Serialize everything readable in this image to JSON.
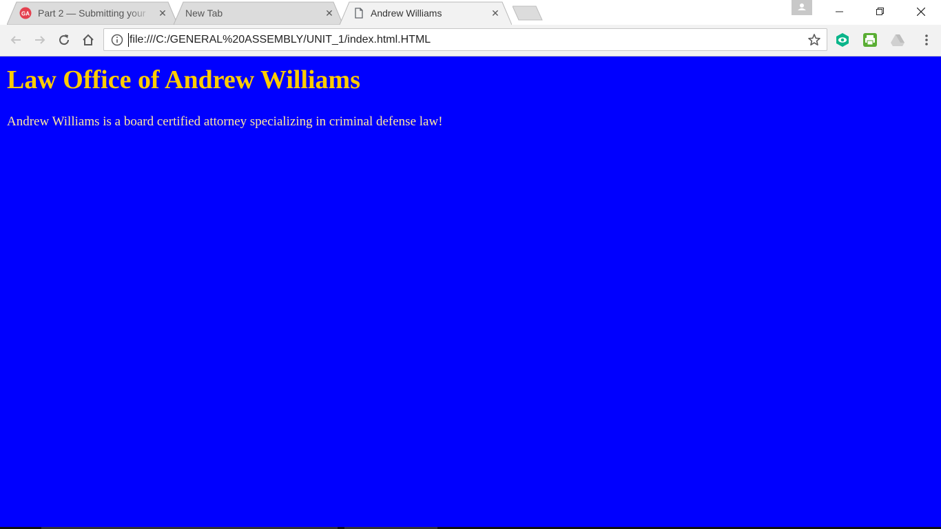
{
  "tabs": [
    {
      "title": "Part 2 — Submitting your",
      "favicon": "ga-logo-icon",
      "active": false
    },
    {
      "title": "New Tab",
      "favicon": "",
      "active": false
    },
    {
      "title": "Andrew Williams",
      "favicon": "document-icon",
      "active": true
    }
  ],
  "toolbar": {
    "url": "file:///C:/GENERAL%20ASSEMBLY/UNIT_1/index.html.HTML"
  },
  "page": {
    "heading": "Law Office of Andrew Williams",
    "body": "Andrew Williams is a board certified attorney specializing in criminal defense law!",
    "background_color": "#0000ff",
    "heading_color": "#ffcc00",
    "text_color": "#ffe8a0"
  },
  "colors": {
    "ga_brand": "#e4404f",
    "eye_extension": "#0ab58a",
    "print_extension": "#5aae34"
  }
}
